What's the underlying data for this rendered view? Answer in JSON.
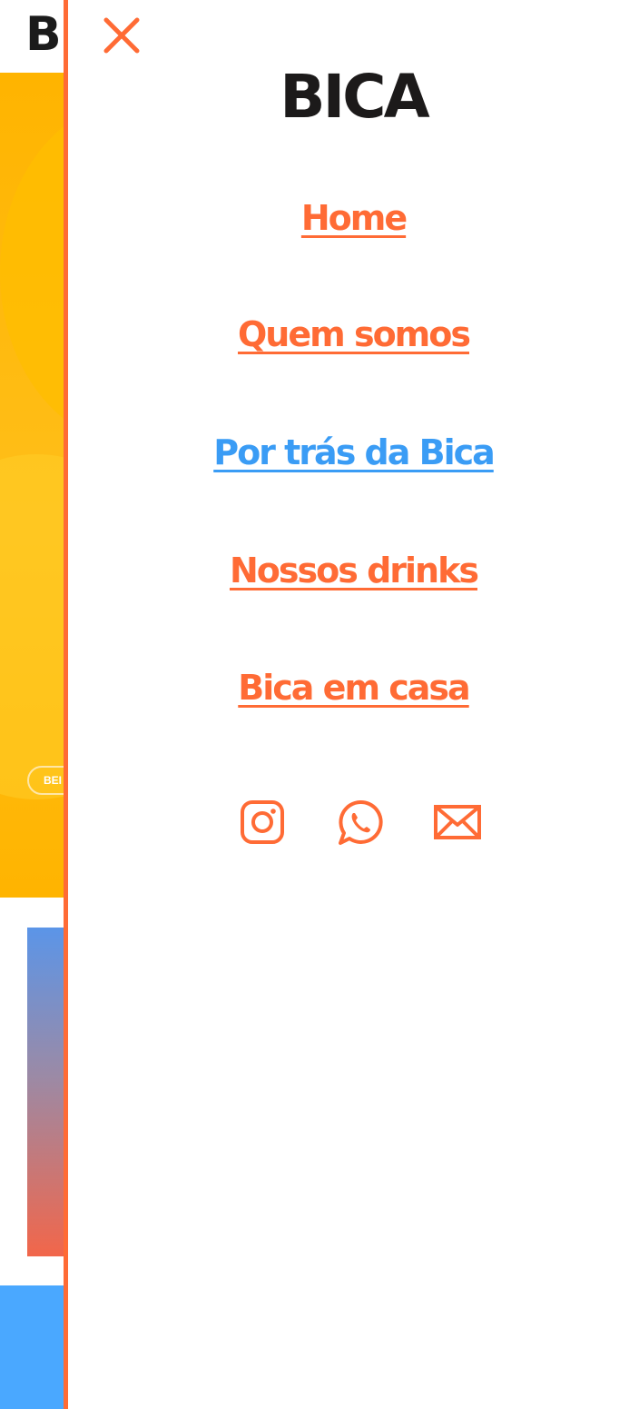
{
  "background_page": {
    "logo_text": "BI",
    "hero_button_label": "BEI",
    "colors": {
      "hero": "#ffb400",
      "card_top": "#5b95e8",
      "card_bottom": "#f2664a",
      "strip": "#4aa8ff"
    }
  },
  "drawer": {
    "close_icon": "close-icon",
    "logo_text": "BICA",
    "nav": [
      {
        "label": "Home",
        "active": false
      },
      {
        "label": "Quem somos",
        "active": false
      },
      {
        "label": "Por trás da Bica",
        "active": true
      },
      {
        "label": "Nossos drinks",
        "active": false
      },
      {
        "label": "Bica em casa",
        "active": false
      }
    ],
    "socials": [
      {
        "icon": "instagram-icon"
      },
      {
        "icon": "whatsapp-icon"
      },
      {
        "icon": "email-icon"
      }
    ],
    "colors": {
      "accent": "#ff6b35",
      "active_link": "#3a9cf5",
      "logo": "#1c1a1a"
    }
  }
}
